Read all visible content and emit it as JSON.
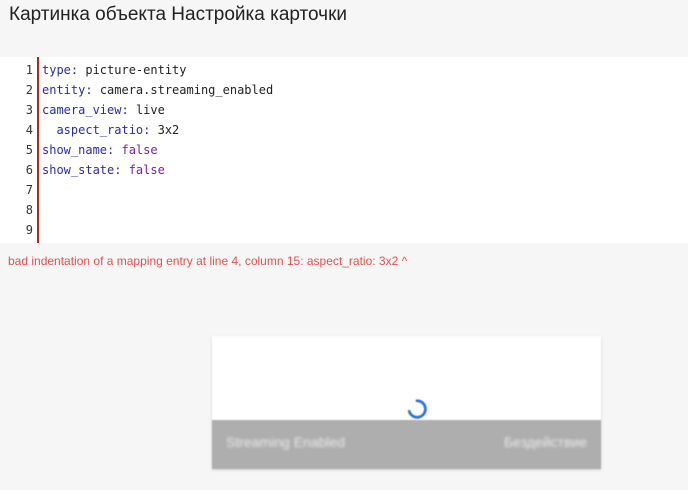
{
  "header": {
    "title": "Картинка объекта Настройка карточки"
  },
  "editor": {
    "line_numbers": [
      "1",
      "2",
      "3",
      "4",
      "5",
      "6",
      "7",
      "8",
      "9"
    ],
    "lines": [
      {
        "key": "type",
        "sep": ": ",
        "value": "picture-entity",
        "value_type": "string",
        "indent": ""
      },
      {
        "key": "entity",
        "sep": ": ",
        "value": "camera.streaming_enabled",
        "value_type": "string",
        "indent": ""
      },
      {
        "key": "camera_view",
        "sep": ": ",
        "value": "live",
        "value_type": "string",
        "indent": ""
      },
      {
        "key": "aspect_ratio",
        "sep": ": ",
        "value": "3x2",
        "value_type": "string",
        "indent": "  "
      },
      {
        "key": "show_name",
        "sep": ": ",
        "value": "false",
        "value_type": "bool",
        "indent": ""
      },
      {
        "key": "show_state",
        "sep": ": ",
        "value": "false",
        "value_type": "bool",
        "indent": ""
      },
      {
        "key": "",
        "sep": "",
        "value": "",
        "value_type": "empty",
        "indent": ""
      },
      {
        "key": "",
        "sep": "",
        "value": "",
        "value_type": "empty",
        "indent": ""
      },
      {
        "key": "",
        "sep": "",
        "value": "",
        "value_type": "empty",
        "indent": ""
      }
    ]
  },
  "error": {
    "message": "bad indentation of a mapping entry at line 4, column 15: aspect_ratio: 3x2 ^"
  },
  "preview": {
    "name": "Streaming Enabled",
    "state": "Бездействие"
  },
  "colors": {
    "gutter_border": "#b3261e",
    "error_text": "#e05050",
    "key_color": "#2a2aa8",
    "bool_color": "#7a1fa2",
    "spinner": "#2f6fe0"
  },
  "icons": {
    "spinner": "loading-spinner-icon"
  }
}
